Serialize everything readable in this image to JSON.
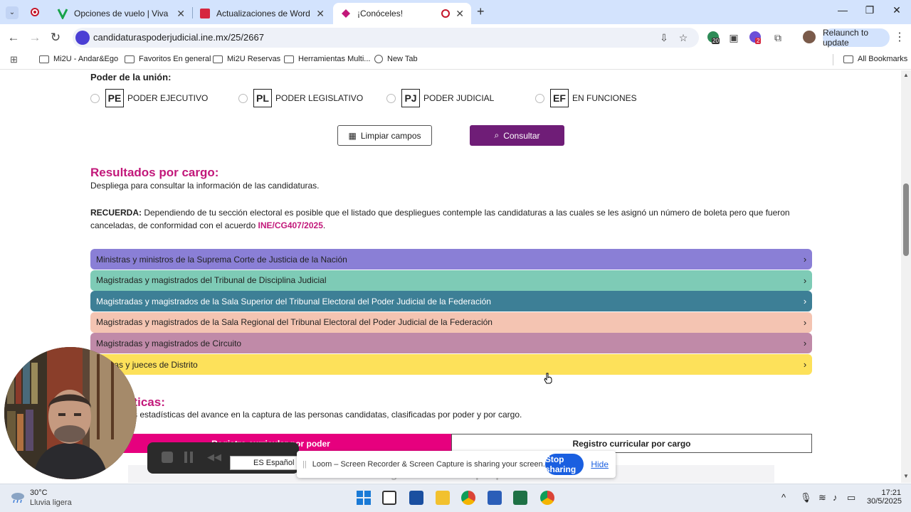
{
  "browser": {
    "tabs": [
      {
        "title": "Opciones de vuelo | Viva",
        "active": false
      },
      {
        "title": "Actualizaciones de WordPress",
        "active": false
      },
      {
        "title": "¡Conóceles!",
        "active": true
      }
    ],
    "new_tab_symbol": "+",
    "url": "candidaturaspoderjudicial.ine.mx/25/2667",
    "relaunch_label": "Relaunch to update",
    "extension_badges": [
      "20",
      "2"
    ],
    "bookmarks": [
      {
        "label": "Mi2U - Andar&Ego",
        "icon": "folder-icon"
      },
      {
        "label": "Favoritos En general",
        "icon": "folder-icon"
      },
      {
        "label": "Mi2U Reservas",
        "icon": "folder-icon"
      },
      {
        "label": "Herramientas Multi...",
        "icon": "folder-icon"
      },
      {
        "label": "New Tab",
        "icon": "globe-icon"
      }
    ],
    "all_bookmarks_label": "All Bookmarks"
  },
  "filters": {
    "heading": "Poder de la unión:",
    "options": [
      {
        "abbr": "PE",
        "label": "PODER EJECUTIVO"
      },
      {
        "abbr": "PL",
        "label": "PODER LEGISLATIVO"
      },
      {
        "abbr": "PJ",
        "label": "PODER JUDICIAL"
      },
      {
        "abbr": "EF",
        "label": "EN FUNCIONES"
      }
    ],
    "clear_label": "Limpiar campos",
    "query_label": "Consultar"
  },
  "results": {
    "title": "Resultados por cargo:",
    "description": "Despliega para consultar la información de las candidaturas.",
    "notice_label": "RECUERDA:",
    "notice_text": " Dependiendo de tu sección electoral es posible que el listado que despliegues contemple las candidaturas a las cuales se les asignó un número de boleta pero que fueron canceladas, de conformidad con el acuerdo ",
    "notice_agreement": "INE/CG407/2025",
    "notice_end": ".",
    "positions": [
      {
        "label": "Ministras y ministros de la Suprema Corte de Justicia de la Nación",
        "color": "#8a7fd6",
        "text_color": "#222222"
      },
      {
        "label": "Magistradas y magistrados del Tribunal de Disciplina Judicial",
        "color": "#7ecbb6",
        "text_color": "#222222"
      },
      {
        "label": "Magistradas y magistrados de la Sala Superior del Tribunal Electoral del Poder Judicial de la Federación",
        "color": "#3d7f96",
        "text_color": "#ffffff"
      },
      {
        "label": "Magistradas y magistrados de la Sala Regional del Tribunal Electoral del Poder Judicial de la Federación",
        "color": "#f4c4b2",
        "text_color": "#222222"
      },
      {
        "label": "Magistradas y magistrados de Circuito",
        "color": "#c08aa8",
        "text_color": "#222222"
      },
      {
        "label": "Juezas y jueces de Distrito",
        "color": "#fde15a",
        "text_color": "#222222"
      }
    ]
  },
  "stats": {
    "title": "Estadísticas:",
    "description": "Consulta las estadísticas del avance en la captura de las personas candidatas, clasificadas por poder y por cargo.",
    "tab_by_power": "Registro curricular por poder",
    "tab_by_position": "Registro curricular por cargo",
    "panel_heading": "Registro curricular por poder"
  },
  "loom": {
    "language_chip": "ES Español (La",
    "message": "Loom – Screen Recorder & Screen Capture is sharing your screen.",
    "stop_label": "Stop sharing",
    "hide_label": "Hide"
  },
  "taskbar": {
    "temperature": "30°C",
    "weather": "Lluvia ligera",
    "time": "17:21",
    "date": "30/5/2025"
  },
  "colors": {
    "brand_magenta": "#c2187a",
    "query_button": "#6f1d77",
    "tab_active": "#e6007e",
    "loom_blue": "#1a5fe0"
  }
}
